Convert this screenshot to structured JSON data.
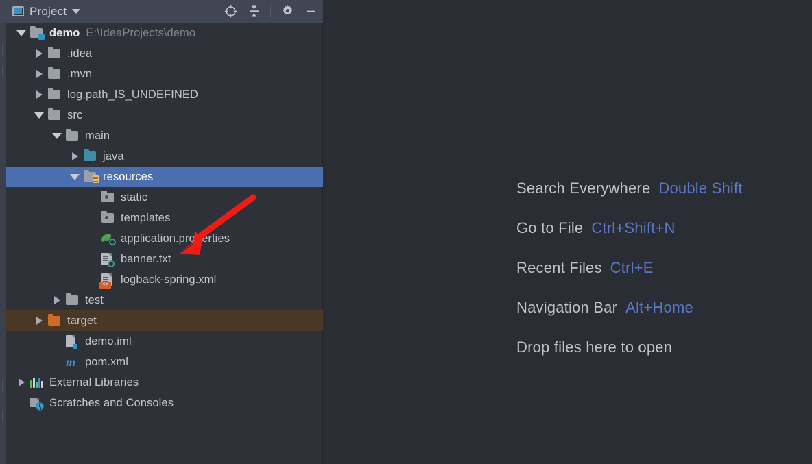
{
  "panel": {
    "title": "Project",
    "title_caret_icon": "chevron-down-icon",
    "window_icon": "project-window-icon",
    "actions": [
      {
        "name": "select-opened-file-icon",
        "glyph": "crosshair"
      },
      {
        "name": "collapse-all-icon",
        "glyph": "collapse"
      },
      {
        "name": "settings-gear-icon",
        "glyph": "gear"
      },
      {
        "name": "hide-panel-icon",
        "glyph": "minimize"
      }
    ]
  },
  "tree": {
    "rows": [
      {
        "label": "demo",
        "secondary": "E:\\IdeaProjects\\demo",
        "indent": 0,
        "arrow": "down",
        "icon": "folder-project",
        "bold": true,
        "state": "normal"
      },
      {
        "label": ".idea",
        "secondary": "",
        "indent": 1,
        "arrow": "right",
        "icon": "folder-gray",
        "bold": false,
        "state": "normal"
      },
      {
        "label": ".mvn",
        "secondary": "",
        "indent": 1,
        "arrow": "right",
        "icon": "folder-gray",
        "bold": false,
        "state": "normal"
      },
      {
        "label": "log.path_IS_UNDEFINED",
        "secondary": "",
        "indent": 1,
        "arrow": "right",
        "icon": "folder-gray",
        "bold": false,
        "state": "normal"
      },
      {
        "label": "src",
        "secondary": "",
        "indent": 1,
        "arrow": "down",
        "icon": "folder-gray",
        "bold": false,
        "state": "normal"
      },
      {
        "label": "main",
        "secondary": "",
        "indent": 2,
        "arrow": "down",
        "icon": "folder-gray",
        "bold": false,
        "state": "normal"
      },
      {
        "label": "java",
        "secondary": "",
        "indent": 3,
        "arrow": "right",
        "icon": "folder-teal",
        "bold": false,
        "state": "normal"
      },
      {
        "label": "resources",
        "secondary": "",
        "indent": 3,
        "arrow": "down",
        "icon": "folder-resources",
        "bold": false,
        "state": "selected"
      },
      {
        "label": "static",
        "secondary": "",
        "indent": 4,
        "arrow": "none",
        "icon": "folder-dot",
        "bold": false,
        "state": "normal"
      },
      {
        "label": "templates",
        "secondary": "",
        "indent": 4,
        "arrow": "none",
        "icon": "folder-dot",
        "bold": false,
        "state": "normal"
      },
      {
        "label": "application.properties",
        "secondary": "",
        "indent": 4,
        "arrow": "none",
        "icon": "spring-properties-icon",
        "bold": false,
        "state": "normal"
      },
      {
        "label": "banner.txt",
        "secondary": "",
        "indent": 4,
        "arrow": "none",
        "icon": "spring-text-icon",
        "bold": false,
        "state": "normal"
      },
      {
        "label": "logback-spring.xml",
        "secondary": "",
        "indent": 4,
        "arrow": "none",
        "icon": "xml-file-icon",
        "bold": false,
        "state": "normal"
      },
      {
        "label": "test",
        "secondary": "",
        "indent": 2,
        "arrow": "right",
        "icon": "folder-gray",
        "bold": false,
        "state": "normal"
      },
      {
        "label": "target",
        "secondary": "",
        "indent": 1,
        "arrow": "right",
        "icon": "folder-orange",
        "bold": false,
        "state": "excluded"
      },
      {
        "label": "demo.iml",
        "secondary": "",
        "indent": 2,
        "arrow": "none",
        "icon": "iml-file-icon",
        "bold": false,
        "state": "normal"
      },
      {
        "label": "pom.xml",
        "secondary": "",
        "indent": 2,
        "arrow": "none",
        "icon": "maven-icon",
        "bold": false,
        "state": "normal"
      },
      {
        "label": "External Libraries",
        "secondary": "",
        "indent": 0,
        "arrow": "right",
        "icon": "libraries-icon",
        "bold": false,
        "state": "normal"
      },
      {
        "label": "Scratches and Consoles",
        "secondary": "",
        "indent": 0,
        "arrow": "none",
        "icon": "scratches-icon",
        "bold": false,
        "state": "normal"
      }
    ]
  },
  "editor": {
    "hints": [
      {
        "label": "Search Everywhere",
        "key": "Double Shift"
      },
      {
        "label": "Go to File",
        "key": "Ctrl+Shift+N"
      },
      {
        "label": "Recent Files",
        "key": "Ctrl+E"
      },
      {
        "label": "Navigation Bar",
        "key": "Alt+Home"
      },
      {
        "label": "Drop files here to open",
        "key": ""
      }
    ]
  },
  "annotation": {
    "arrow_icon": "red-arrow-annotation",
    "color": "#ee1c15",
    "points_at": "banner.txt"
  },
  "colors": {
    "panel_bg": "#2f3139",
    "editor_bg": "#2b2d35",
    "header_bg": "#414654",
    "selection": "#4b6eaf",
    "excluded": "#4a3724",
    "hint_key": "#5978c8",
    "text": "#c3c6cc"
  }
}
